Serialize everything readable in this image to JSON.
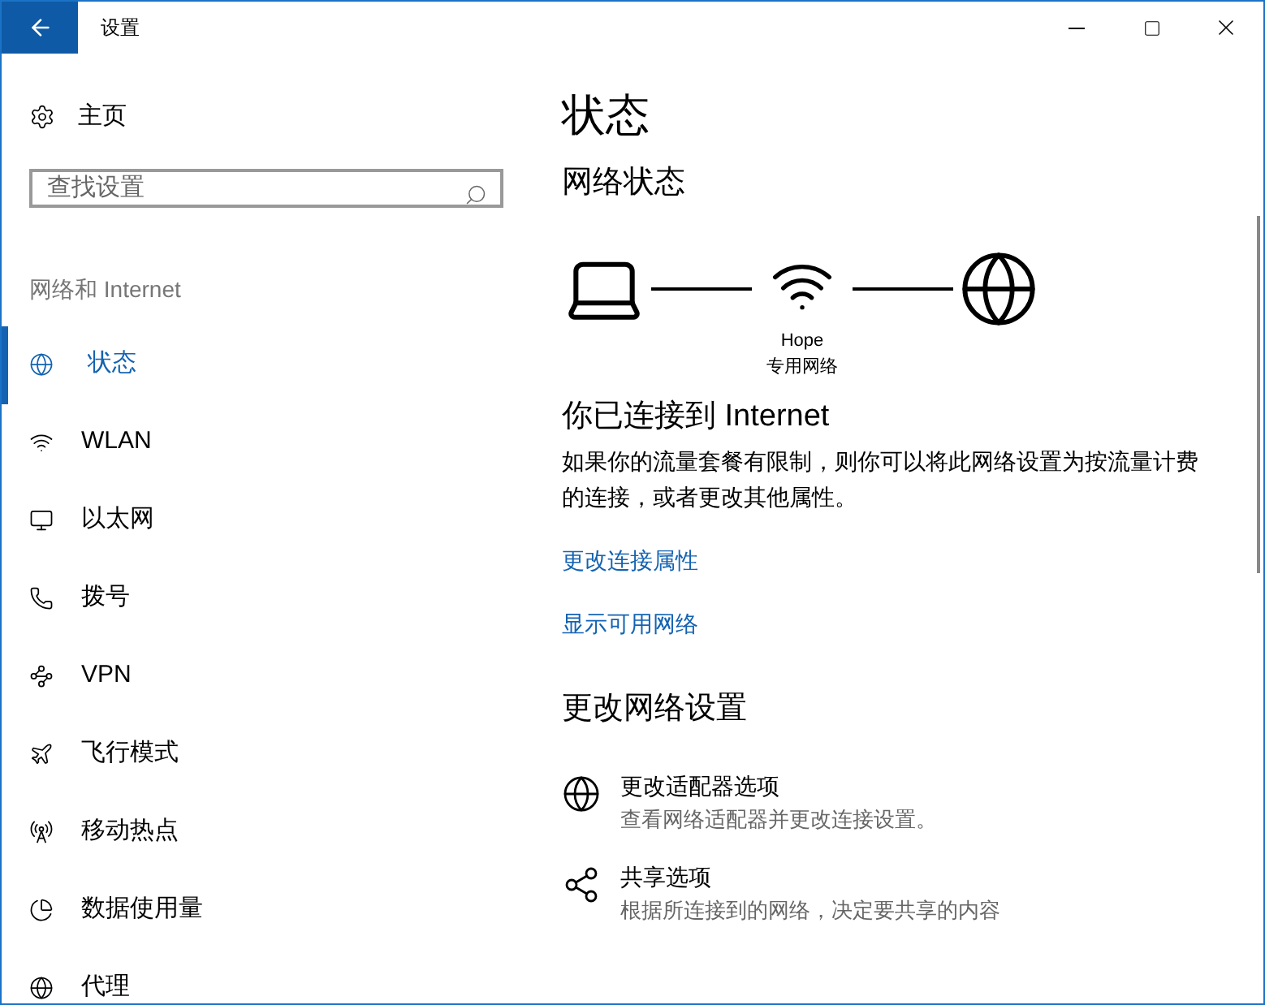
{
  "window": {
    "title": "设置"
  },
  "sidebar": {
    "home": "主页",
    "search": {
      "placeholder": "查找设置"
    },
    "section": "网络和 Internet",
    "items": [
      {
        "label": "状态",
        "kind": "status",
        "selected": true
      },
      {
        "label": "WLAN",
        "kind": "wifi",
        "selected": false
      },
      {
        "label": "以太网",
        "kind": "ethernet",
        "selected": false
      },
      {
        "label": "拨号",
        "kind": "dialup",
        "selected": false
      },
      {
        "label": "VPN",
        "kind": "vpn",
        "selected": false
      },
      {
        "label": "飞行模式",
        "kind": "airplane",
        "selected": false
      },
      {
        "label": "移动热点",
        "kind": "hotspot",
        "selected": false
      },
      {
        "label": "数据使用量",
        "kind": "data",
        "selected": false
      },
      {
        "label": "代理",
        "kind": "proxy",
        "selected": false
      }
    ]
  },
  "main": {
    "title": "状态",
    "network_status": "网络状态",
    "network": {
      "name": "Hope",
      "type": "专用网络"
    },
    "connected_title": "你已连接到 Internet",
    "connected_text": "如果你的流量套餐有限制，则你可以将此网络设置为按流量计费的连接，或者更改其他属性。",
    "links": [
      "更改连接属性",
      "显示可用网络"
    ],
    "change_title": "更改网络设置",
    "options": [
      {
        "kind": "adapter",
        "title": "更改适配器选项",
        "description": "查看网络适配器并更改连接设置。"
      },
      {
        "kind": "sharing",
        "title": "共享选项",
        "description": "根据所连接到的网络，决定要共享的内容"
      }
    ]
  }
}
